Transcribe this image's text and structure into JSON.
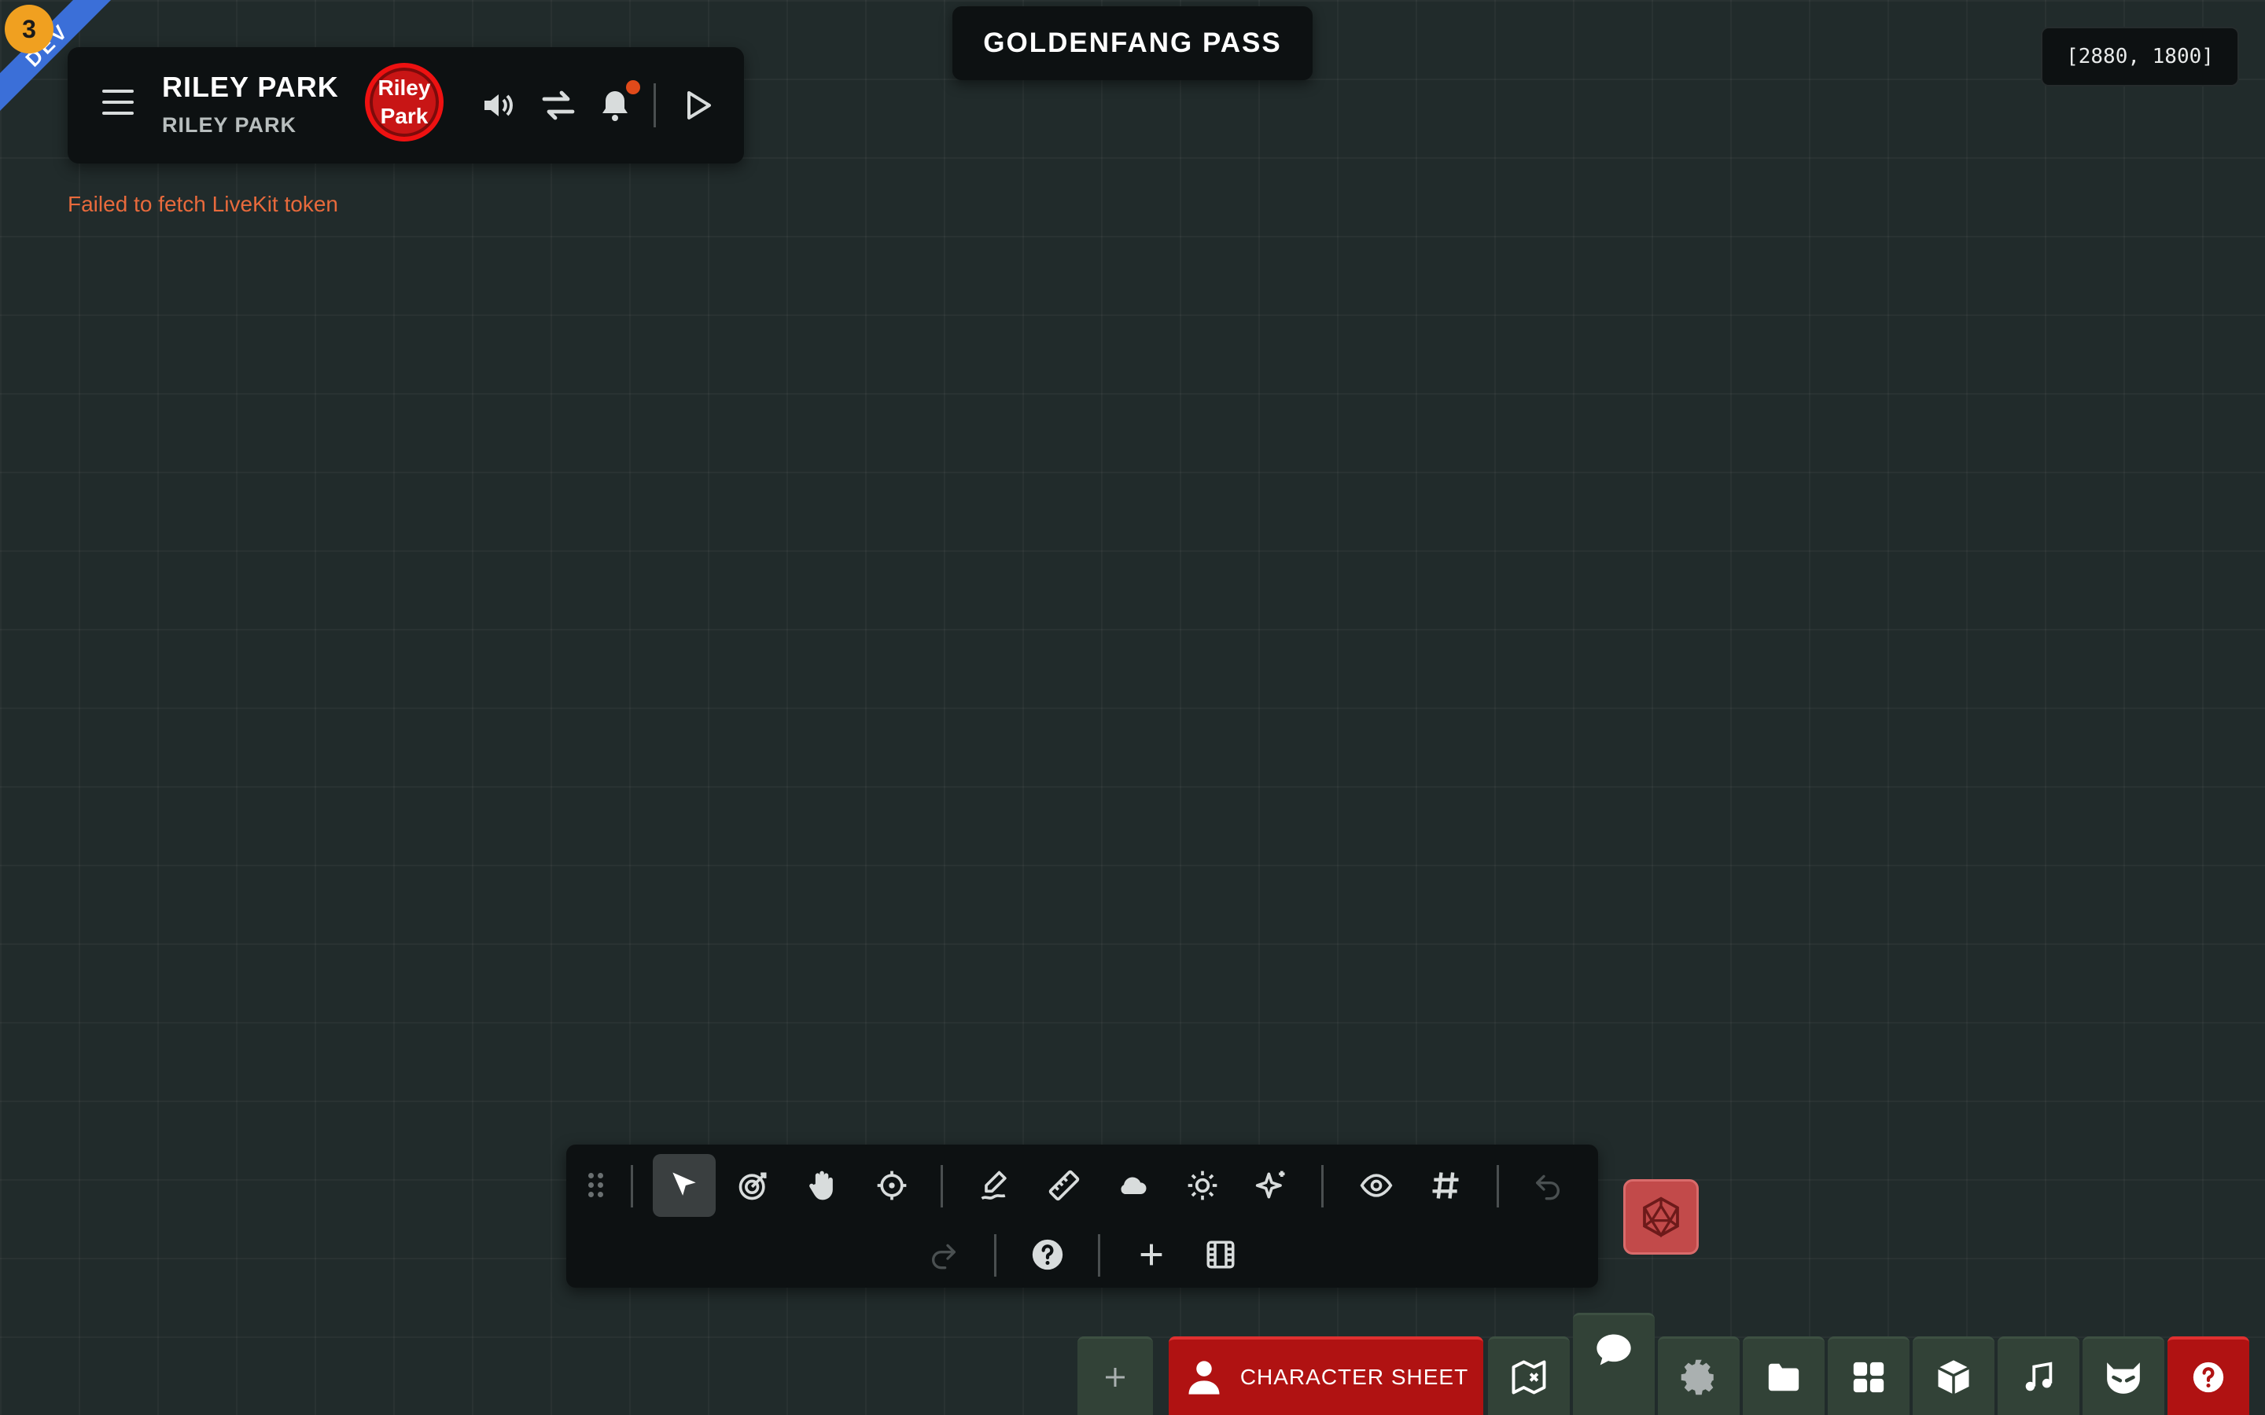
{
  "dev": {
    "badge_count": "3",
    "ribbon_label": "DEV"
  },
  "header": {
    "title": "RILEY PARK",
    "subtitle": "RILEY PARK",
    "avatar_text": "Riley\nPark",
    "icons": [
      "menu-icon",
      "volume-icon",
      "swap-icon",
      "bell-icon",
      "play-icon"
    ]
  },
  "error": {
    "message": "Failed to fetch LiveKit token"
  },
  "scene": {
    "title": "GOLDENFANG PASS"
  },
  "viewport": {
    "size_label": "[2880, 1800]"
  },
  "toolbar": {
    "tools": [
      "select",
      "target",
      "pan",
      "crosshair",
      "draw",
      "measure",
      "fog",
      "light",
      "effects",
      "visibility",
      "grid",
      "undo",
      "redo",
      "help",
      "add",
      "scenes"
    ],
    "active_tool": "select"
  },
  "bottom_bar": {
    "character_sheet_label": "CHARACTER SHEET",
    "tabs": [
      "add",
      "character-sheet",
      "map",
      "chat",
      "settings",
      "folder",
      "widgets",
      "box",
      "music",
      "mask",
      "help"
    ]
  },
  "colors": {
    "accent_red": "#b01212",
    "error": "#e86a3c",
    "dev_badge": "#f0a020",
    "dev_ribbon": "#3b6fd8"
  }
}
